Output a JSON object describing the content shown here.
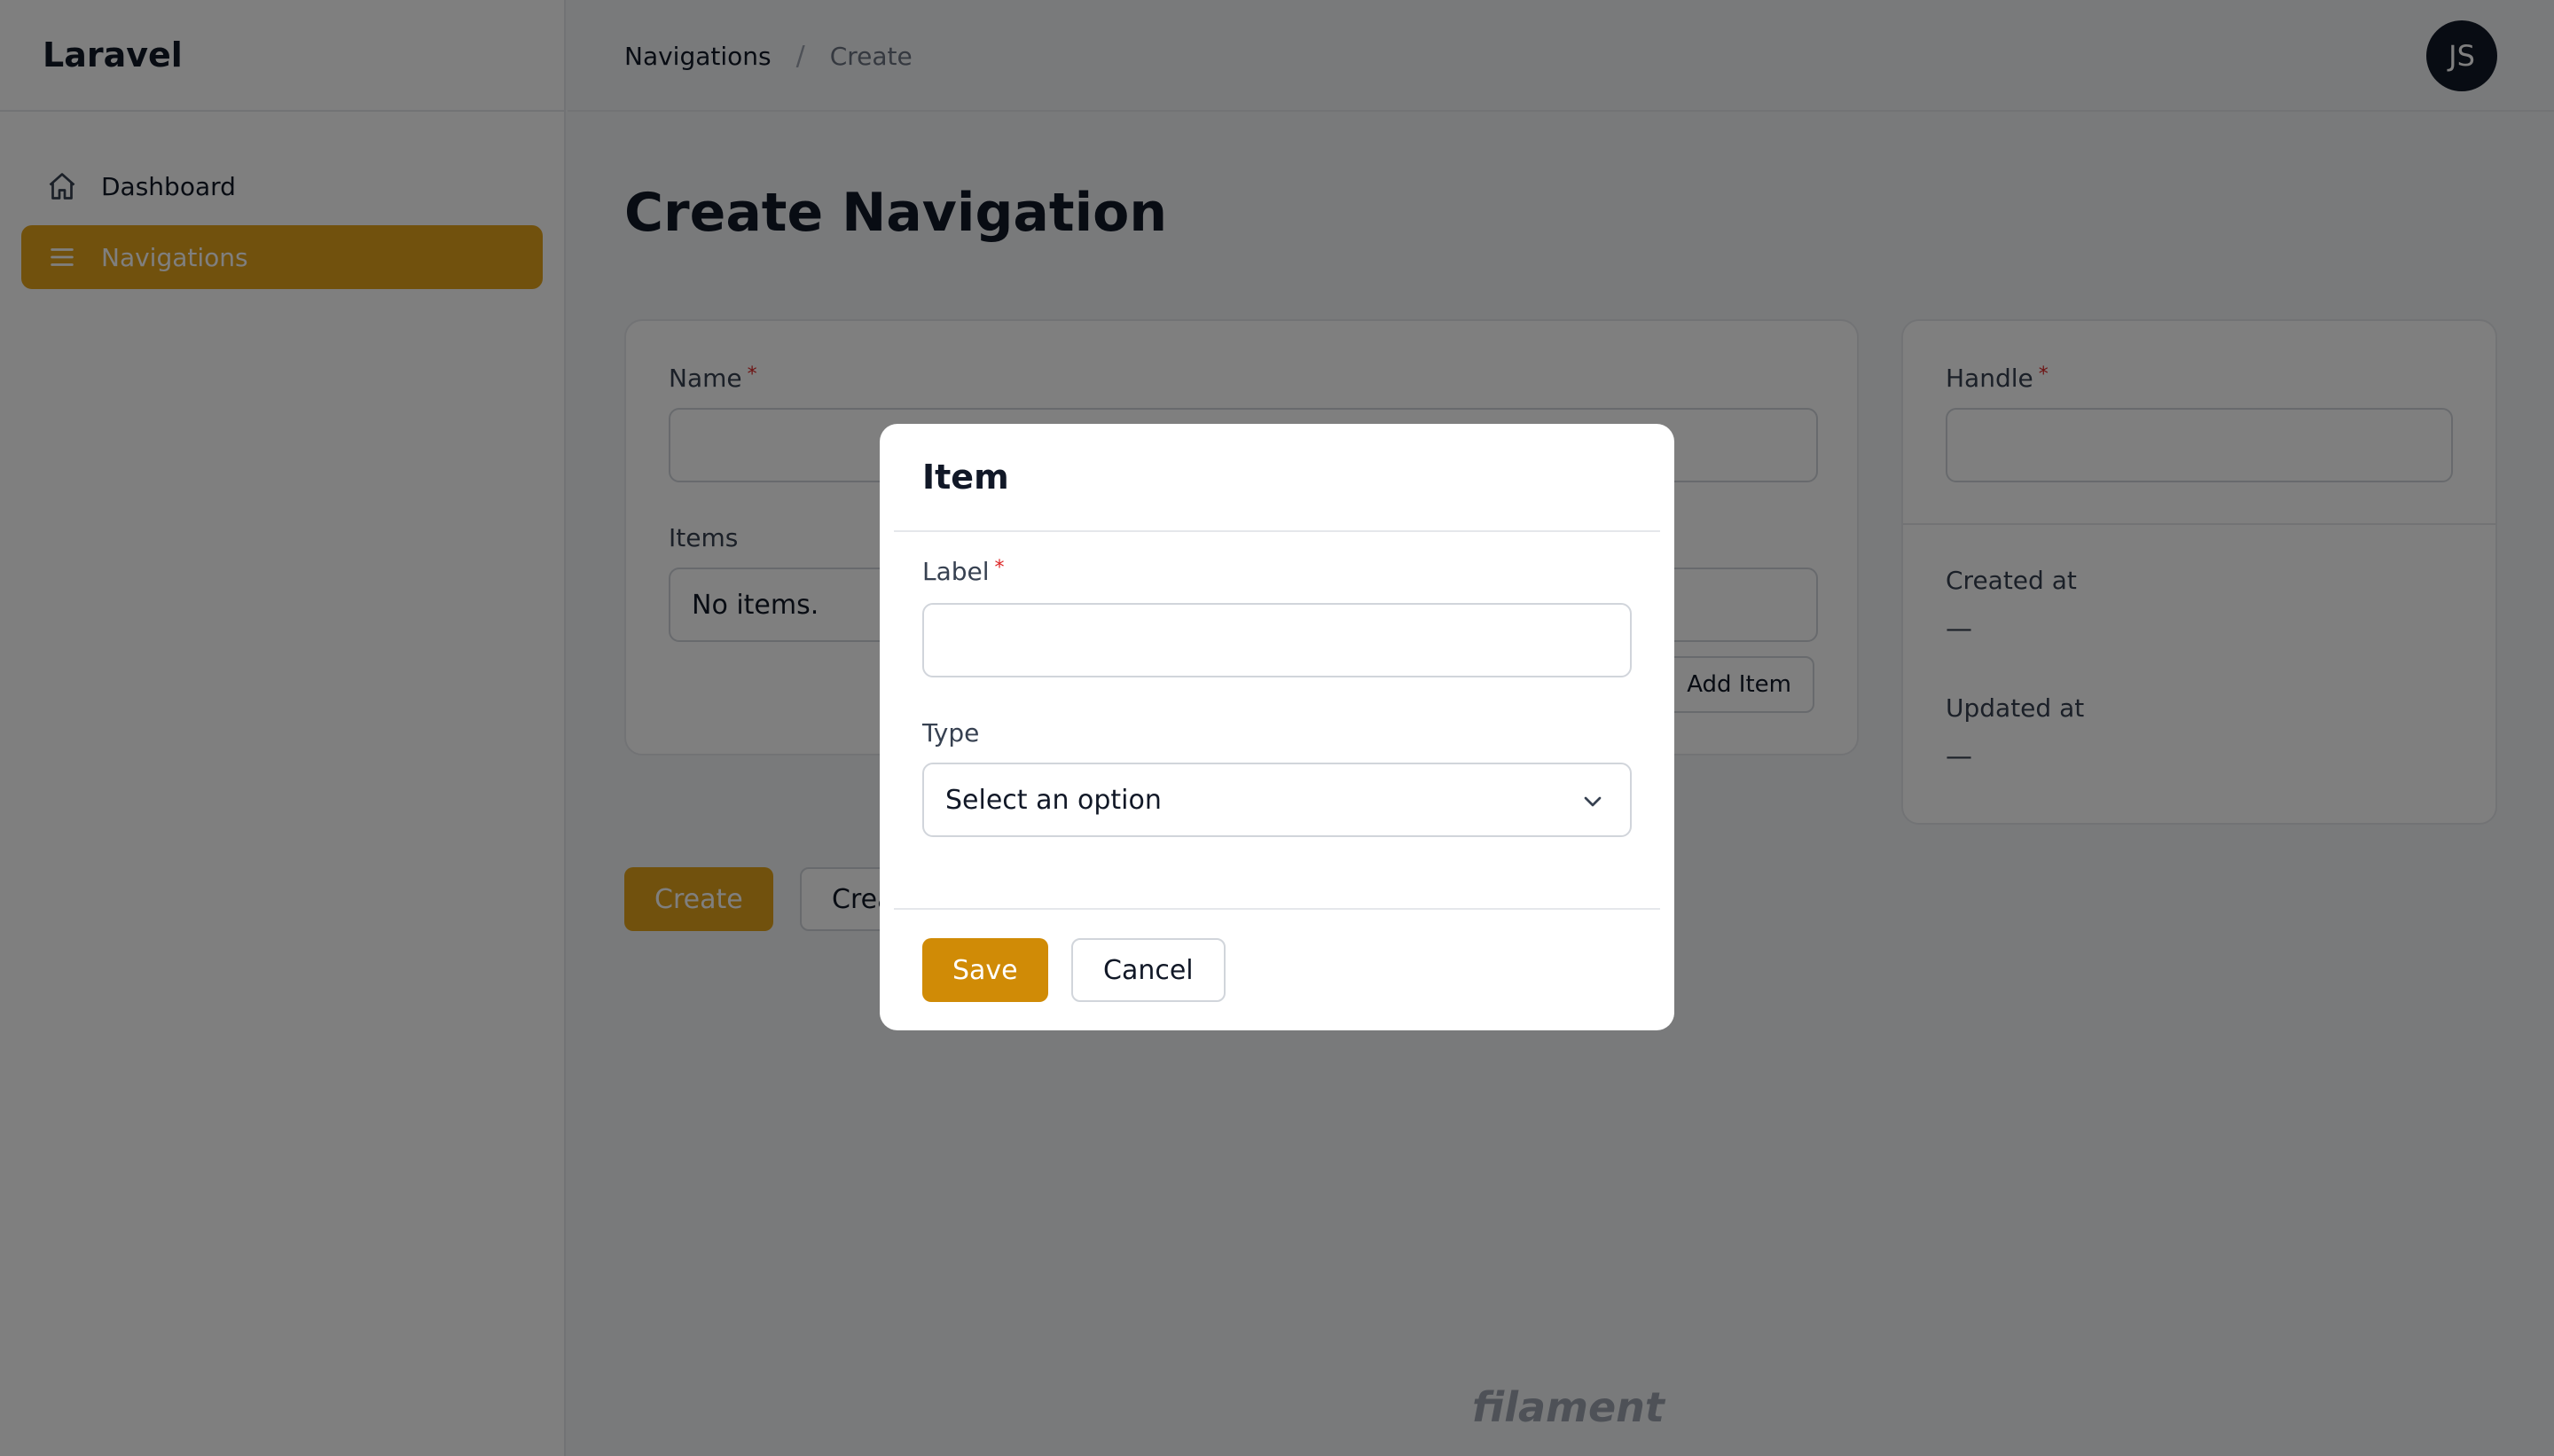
{
  "sidebar": {
    "brand": "Laravel",
    "items": [
      {
        "label": "Dashboard",
        "icon": "home-icon"
      },
      {
        "label": "Navigations",
        "icon": "menu-icon"
      }
    ]
  },
  "topbar": {
    "breadcrumbs": [
      "Navigations",
      "Create"
    ],
    "separator": "/",
    "avatar_initials": "JS"
  },
  "page": {
    "title": "Create Navigation"
  },
  "form": {
    "name_label": "Name",
    "items_label": "Items",
    "items_empty": "No items.",
    "add_item_label": "Add Item",
    "handle_label": "Handle",
    "created_at_label": "Created at",
    "created_at_value": "—",
    "updated_at_label": "Updated at",
    "updated_at_value": "—",
    "required_marker": "*"
  },
  "actions": {
    "create_label": "Create",
    "create_another_label": "Create & create another"
  },
  "footer": {
    "logo_text": "filament"
  },
  "modal": {
    "title": "Item",
    "label_field": "Label",
    "type_field": "Type",
    "type_placeholder": "Select an option",
    "save_label": "Save",
    "cancel_label": "Cancel"
  },
  "colors": {
    "accent": "#e2a31a",
    "overlay": "rgba(0,0,0,0.5)",
    "required": "#dc2626"
  }
}
